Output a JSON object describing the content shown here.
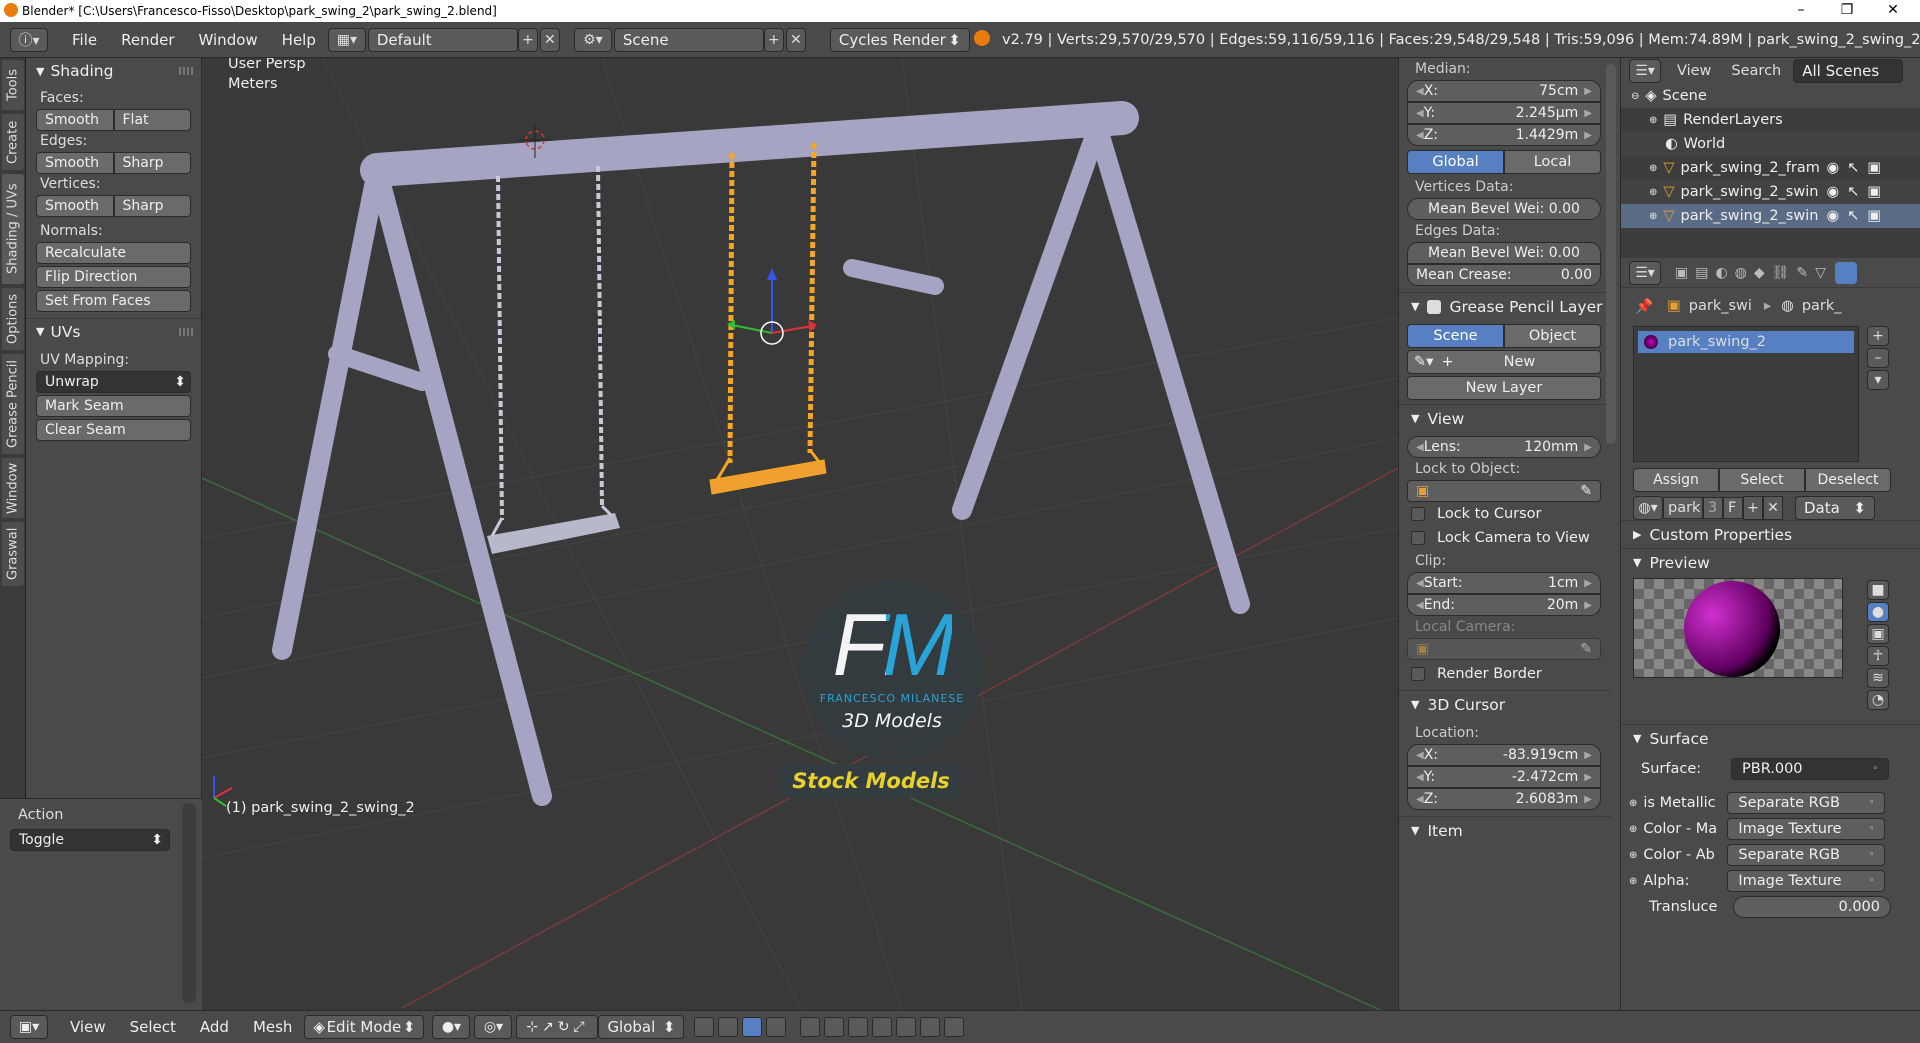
{
  "titlebar": {
    "title": "Blender* [C:\\Users\\Francesco-Fisso\\Desktop\\park_swing_2\\park_swing_2.blend]",
    "minimize": "–",
    "maximize": "❐",
    "close": "✕"
  },
  "topbar": {
    "menus": [
      "File",
      "Render",
      "Window",
      "Help"
    ],
    "layout": "Default",
    "scene": "Scene",
    "engine": "Cycles Render",
    "stats": "v2.79 | Verts:29,570/29,570 | Edges:59,116/59,116 | Faces:29,548/29,548 | Tris:59,096 | Mem:74.89M | park_swing_2_swing_2"
  },
  "vtabs": [
    "Tools",
    "Create",
    "Shading / UVs",
    "Options",
    "Grease Pencil",
    "Window",
    "Graswal"
  ],
  "tools": {
    "shading_title": "Shading",
    "faces": "Faces:",
    "edges": "Edges:",
    "vertices": "Vertices:",
    "smooth": "Smooth",
    "flat": "Flat",
    "sharp": "Sharp",
    "normals": "Normals:",
    "recalculate": "Recalculate",
    "flip": "Flip Direction",
    "set_from_faces": "Set From Faces",
    "uvs_title": "UVs",
    "uv_mapping": "UV Mapping:",
    "unwrap": "Unwrap",
    "mark_seam": "Mark Seam",
    "clear_seam": "Clear Seam"
  },
  "action": {
    "title": "Action",
    "value": "Toggle"
  },
  "viewport": {
    "view_name": "User Persp",
    "units": "Meters",
    "object": "(1) park_swing_2_swing_2",
    "logo_initials": "FM",
    "logo_name": "FRANCESCO MILANESE",
    "logo_sub": "3D Models",
    "logo_stock": "Stock Models"
  },
  "props": {
    "median": "Median:",
    "x_label": "X:",
    "x": "75cm",
    "y_label": "Y:",
    "y": "2.245µm",
    "z_label": "Z:",
    "z": "1.4429m",
    "global": "Global",
    "local": "Local",
    "vdata": "Vertices Data:",
    "mean_bevel_v": "Mean Bevel Wei: 0.00",
    "edata": "Edges Data:",
    "mean_bevel_e": "Mean Bevel Wei: 0.00",
    "mean_crease": "Mean Crease:",
    "mean_crease_val": "0.00",
    "gp_title": "Grease Pencil Layer",
    "scene": "Scene",
    "object": "Object",
    "new": "New",
    "new_layer": "New Layer",
    "view_title": "View",
    "lens": "Lens:",
    "lens_val": "120mm",
    "lock_obj": "Lock to Object:",
    "lock_cursor": "Lock to Cursor",
    "lock_camera": "Lock Camera to View",
    "clip": "Clip:",
    "start": "Start:",
    "start_val": "1cm",
    "end": "End:",
    "end_val": "20m",
    "local_camera": "Local Camera:",
    "render_border": "Render Border",
    "cursor_title": "3D Cursor",
    "location": "Location:",
    "cx": "-83.919cm",
    "cy": "-2.472cm",
    "cz": "2.6083m",
    "item_title": "Item"
  },
  "outliner": {
    "view": "View",
    "search": "Search",
    "filter": "All Scenes",
    "items": [
      "Scene",
      "RenderLayers",
      "World",
      "park_swing_2_fram",
      "park_swing_2_swin",
      "park_swing_2_swin"
    ]
  },
  "material": {
    "crumb1": "park_swi",
    "crumb2": "park_",
    "slot": "park_swing_2",
    "assign": "Assign",
    "select": "Select",
    "deselect": "Deselect",
    "matname": "park",
    "users": "3",
    "fake": "F",
    "link": "Data",
    "custom_props": "Custom Properties",
    "preview": "Preview",
    "surface_title": "Surface",
    "surface_label": "Surface:",
    "surface_val": "PBR.000",
    "inputs": [
      {
        "label": "is Metallic",
        "val": "Separate RGB"
      },
      {
        "label": "Color - Ma",
        "val": "Image Texture"
      },
      {
        "label": "Color - Ab",
        "val": "Separate RGB"
      },
      {
        "label": "Alpha:",
        "val": "Image Texture"
      }
    ],
    "translucent": "Transluce",
    "translucent_val": "0.000"
  },
  "bottombar": {
    "view": "View",
    "select": "Select",
    "add": "Add",
    "mesh": "Mesh",
    "mode": "Edit Mode",
    "orientation": "Global"
  },
  "colors": {
    "accent": "#5680c2",
    "selected": "#f5a623",
    "frame": "#aaaac8",
    "logo_blue": "#29aae1",
    "logo_yellow": "#e8d22a"
  }
}
